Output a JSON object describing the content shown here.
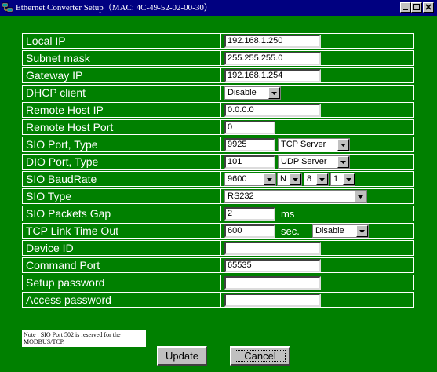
{
  "window": {
    "title": "Ethernet Converter Setup（MAC: 4C-49-52-02-00-30）"
  },
  "fields": {
    "local_ip": {
      "label": "Local IP",
      "value": "192.168.1.250"
    },
    "subnet": {
      "label": "Subnet mask",
      "value": "255.255.255.0"
    },
    "gateway": {
      "label": "Gateway IP",
      "value": "192.168.1.254"
    },
    "dhcp": {
      "label": "DHCP client",
      "value": "Disable"
    },
    "remote_ip": {
      "label": "Remote Host IP",
      "value": "0.0.0.0"
    },
    "remote_port": {
      "label": "Remote Host Port",
      "value": "0"
    },
    "sio_port": {
      "label": "SIO Port, Type",
      "port": "9925",
      "type": "TCP Server"
    },
    "dio_port": {
      "label": "DIO Port, Type",
      "port": "101",
      "type": "UDP Server"
    },
    "baud": {
      "label": "SIO BaudRate",
      "rate": "9600",
      "parity": "N",
      "data_bits": "8",
      "stop_bits": "1"
    },
    "sio_type": {
      "label": "SIO Type",
      "value": "RS232"
    },
    "packets_gap": {
      "label": "SIO Packets Gap",
      "value": "2",
      "unit": "ms"
    },
    "tcp_timeout": {
      "label": "TCP Link Time Out",
      "value": "600",
      "unit": "sec.",
      "mode": "Disable"
    },
    "device_id": {
      "label": "Device ID",
      "value": ""
    },
    "cmd_port": {
      "label": "Command Port",
      "value": "65535"
    },
    "setup_pw": {
      "label": "Setup password",
      "value": ""
    },
    "access_pw": {
      "label": "Access password",
      "value": ""
    }
  },
  "note": "Note : SIO Port 502 is reserved for the MODBUS/TCP.",
  "buttons": {
    "update": "Update",
    "cancel": "Cancel"
  },
  "colors": {
    "background": "#008000",
    "titlebar": "#000080"
  }
}
